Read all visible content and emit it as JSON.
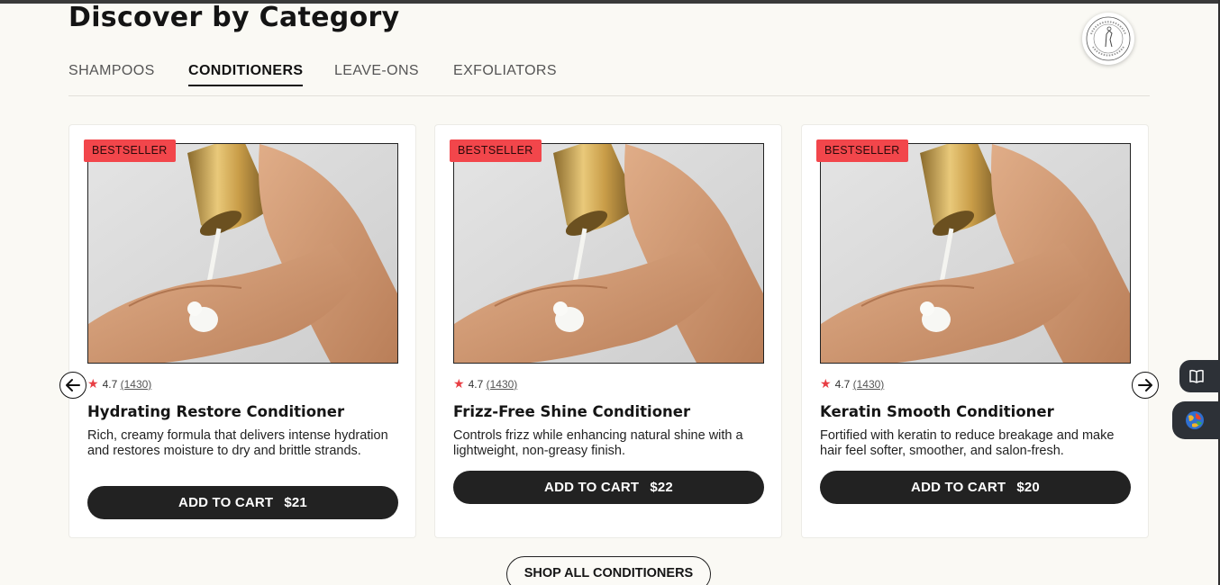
{
  "section": {
    "heading": "Discover by Category",
    "tabs": [
      {
        "label": "SHAMPOOS",
        "active": false
      },
      {
        "label": "CONDITIONERS",
        "active": true
      },
      {
        "label": "LEAVE-ONS",
        "active": false
      },
      {
        "label": "EXFOLIATORS",
        "active": false
      }
    ]
  },
  "products": [
    {
      "badge": "BESTSELLER",
      "rating": "4.7",
      "review_count": "(1430)",
      "name": "Hydrating Restore Conditioner",
      "description": "Rich, creamy formula that delivers intense hydration and restores moisture to dry and brittle strands.",
      "cart_label": "ADD TO CART",
      "price": "$21"
    },
    {
      "badge": "BESTSELLER",
      "rating": "4.7",
      "review_count": "(1430)",
      "name": "Frizz-Free Shine Conditioner",
      "description": "Controls frizz while enhancing natural shine with a lightweight, non-greasy finish.",
      "cart_label": "ADD TO CART",
      "price": "$22"
    },
    {
      "badge": "BESTSELLER",
      "rating": "4.7",
      "review_count": "(1430)",
      "name": "Keratin Smooth Conditioner",
      "description": "Fortified with keratin to reduce breakage and make hair feel softer, smoother, and salon-fresh.",
      "cart_label": "ADD TO CART",
      "price": "$20"
    }
  ],
  "shop_all_label": "SHOP ALL CONDITIONERS",
  "icons": {
    "prev": "arrow-left-icon",
    "next": "arrow-right-icon",
    "star": "star-icon",
    "reader": "book-icon",
    "translate": "globe-icon",
    "seal": "brand-seal"
  },
  "colors": {
    "badge": "#f2464b",
    "star": "#e83e44",
    "button": "#222222",
    "background": "#faf9f4"
  }
}
